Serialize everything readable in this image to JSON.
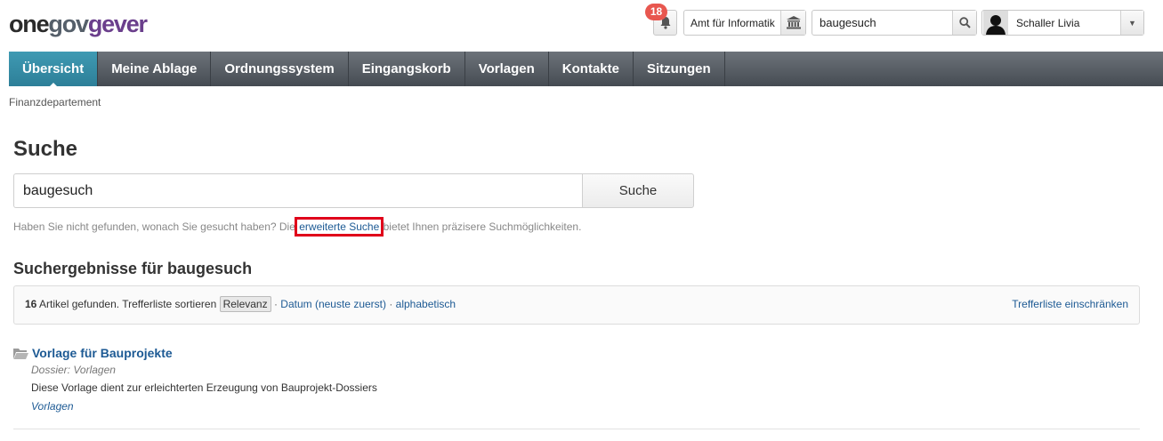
{
  "header": {
    "logo": {
      "part1": "one",
      "part2": "gov",
      "part3": "gever"
    },
    "notifications": {
      "count": "18",
      "icon": "bell-icon"
    },
    "org_unit": {
      "label": "Amt für Informatik",
      "icon": "institution-icon"
    },
    "top_search": {
      "value": "baugesuch",
      "icon": "magnifier-icon"
    },
    "user": {
      "name": "Schaller Livia",
      "icon": "chevron-down-icon"
    }
  },
  "nav": {
    "tabs": [
      {
        "label": "Übersicht",
        "active": true
      },
      {
        "label": "Meine Ablage"
      },
      {
        "label": "Ordnungssystem"
      },
      {
        "label": "Eingangskorb"
      },
      {
        "label": "Vorlagen"
      },
      {
        "label": "Kontakte"
      },
      {
        "label": "Sitzungen"
      }
    ]
  },
  "breadcrumb": "Finanzdepartement",
  "page_title": "Suche",
  "search": {
    "value": "baugesuch",
    "button_label": "Suche"
  },
  "hint": {
    "before": "Haben Sie nicht gefunden, wonach Sie gesucht haben? Die ",
    "link": "erweiterte Suche",
    "after": " bietet Ihnen präzisere Suchmöglichkeiten."
  },
  "results": {
    "title": "Suchergebnisse für baugesuch",
    "count": "16",
    "found_text": " Artikel gefunden. Trefferliste sortieren ",
    "sort_relevance": "Relevanz",
    "sort_date": "Datum (neuste zuerst)",
    "sort_alpha": "alphabetisch",
    "separator": " · ",
    "refine": "Trefferliste einschränken",
    "items": [
      {
        "title": "Vorlage für Bauprojekte",
        "meta": "Dossier: Vorlagen",
        "description": "Diese Vorlage dient zur erleichterten Erzeugung von Bauprojekt-Dossiers",
        "path": "Vorlagen",
        "icon": "folder-icon"
      }
    ]
  }
}
